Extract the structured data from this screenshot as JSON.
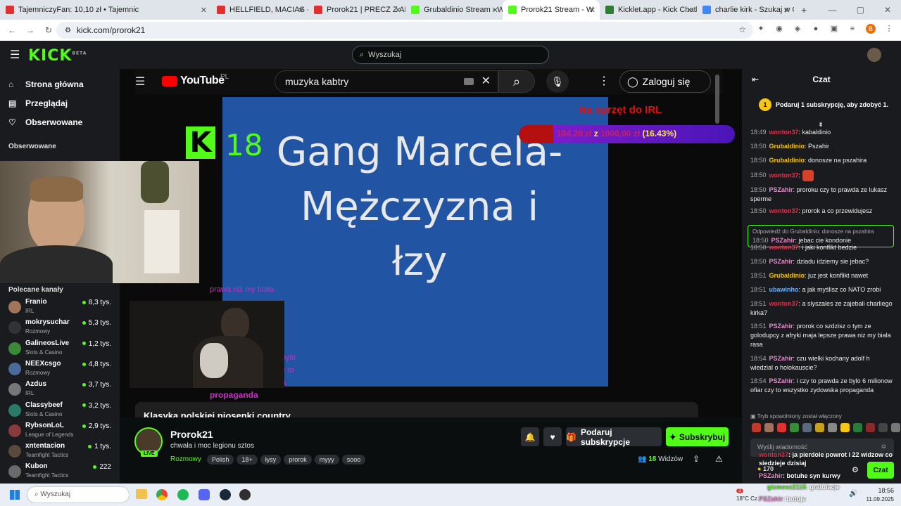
{
  "browser": {
    "tabs": [
      {
        "title": "TajemniczyFan: 10,10 zł • Tajemnic",
        "color": "#e03030"
      },
      {
        "title": "HELLFIELD, MACIAS - Fen",
        "color": "#e03030"
      },
      {
        "title": "Prorok21 | PRECZ Z ABST",
        "color": "#e03030"
      },
      {
        "title": "Grubaldinio Stream - Wa",
        "color": "#53fc18"
      },
      {
        "title": "Prorok21 Stream - W",
        "color": "#53fc18",
        "active": true
      },
      {
        "title": "Kicklet.app - Kick Chatbo",
        "color": "#2e7d32"
      },
      {
        "title": "charlie kirk - Szukaj w Go",
        "color": "#4285f4"
      }
    ],
    "new_tab": "+",
    "url": "kick.com/prorok21",
    "profile_initial": "B"
  },
  "kick": {
    "logo": "KICK",
    "logo_tag": "BETA",
    "search_placeholder": "Wyszukaj",
    "nav": [
      {
        "label": "Strona główna",
        "icon": "home-icon",
        "glyph": "⌂"
      },
      {
        "label": "Przeglądaj",
        "icon": "browse-icon",
        "glyph": "▤"
      },
      {
        "label": "Obserwowane",
        "icon": "heart-icon",
        "glyph": "♡"
      }
    ],
    "followed_title": "Obserwowane",
    "recommended_title": "Polecane kanały",
    "channels": [
      {
        "name": "Franio",
        "category": "IRL",
        "viewers": "8,3 tys.",
        "color": "#a0765a"
      },
      {
        "name": "mokrysuchar",
        "category": "Rozmowy",
        "viewers": "5,3 tys.",
        "color": "#333333"
      },
      {
        "name": "GalineosLive",
        "category": "Slots & Casino",
        "viewers": "1,2 tys.",
        "color": "#3a8a3a"
      },
      {
        "name": "NEEXcsgo",
        "category": "Rozmowy",
        "viewers": "4,8 tys.",
        "color": "#4a6a9a"
      },
      {
        "name": "Azdus",
        "category": "IRL",
        "viewers": "3,7 tys.",
        "color": "#777777"
      },
      {
        "name": "Classybeef",
        "category": "Slots & Casino",
        "viewers": "3,2 tys.",
        "color": "#2a7a6a"
      },
      {
        "name": "RybsonLoL",
        "category": "League of Legends",
        "viewers": "2,9 tys.",
        "color": "#8a3a3a"
      },
      {
        "name": "xntentacion",
        "category": "Teamfight Tactics",
        "viewers": "1 tys.",
        "color": "#5a4a3a"
      },
      {
        "name": "Kubon",
        "category": "Teamfight Tactics",
        "viewers": "222",
        "color": "#6a6a6a"
      }
    ]
  },
  "player": {
    "yt_logo": "YouTube",
    "yt_region": "PL",
    "yt_query": "muzyka kabtry",
    "yt_login": "Zaloguj się",
    "kick_badge": "18",
    "gang_text": "Gang Marcela-\nMężczyzna i\nłzy",
    "goal_title": "Na sprzęt do IRL",
    "goal_amount": "184,28 zł",
    "goal_of": "z",
    "goal_target": "1000,00 zł",
    "goal_pct_text": "(16.43%)",
    "goal_fraction": 0.1643,
    "overlay_text1": "prawa niż my biała",
    "overlay_text2": "bylo\ny to\na",
    "overlay_text3": "propaganda",
    "below_title": "Klasyka polskiej piosenki country"
  },
  "stream": {
    "name": "Prorok21",
    "title": "chwała i moc legionu sztos",
    "live_badge": "LIVE",
    "category": "Rozmowy",
    "tags": [
      "Polish",
      "18+",
      "łysy",
      "prorok",
      "myyy",
      "sooo"
    ],
    "gift_label": "Podaruj subskrypcje",
    "subscribe_label": "Subskrybuj",
    "viewers": "18",
    "viewers_label": "Widzów"
  },
  "chat": {
    "title": "Czat",
    "gift_banner": "Podaruj 1 subskrypcję, aby zdobyć 1.",
    "gift_count": "1",
    "messages": [
      {
        "time": "18:49",
        "user": "wonton37",
        "color": "#e0304a",
        "text": "kabaldinio"
      },
      {
        "time": "18:50",
        "user": "Grubaldinio",
        "color": "#f5c518",
        "text": "Pszahir"
      },
      {
        "time": "18:50",
        "user": "Grubaldinio",
        "color": "#f5c518",
        "text": "donosze na pszahira"
      },
      {
        "time": "18:50",
        "user": "wonton37",
        "color": "#e0304a",
        "text": "",
        "emote": true
      },
      {
        "time": "18:50",
        "user": "PSZahir",
        "color": "#e88acb",
        "text": "proroku czy to prawda ze lukasz sperme"
      },
      {
        "time": "18:50",
        "user": "wonton37",
        "color": "#e0304a",
        "text": "prorok a co przewidujesz"
      },
      {
        "time": "18:50",
        "user": "PSZahir",
        "color": "#e88acb",
        "text": "jebac cie kondonie",
        "reply": "Odpowiedź do Grubaldinio: donosze na pszahira"
      },
      {
        "time": "18:50",
        "user": "wonton37",
        "color": "#e0304a",
        "text": "i jaki konflikt bedzie"
      },
      {
        "time": "18:50",
        "user": "PSZahir",
        "color": "#e88acb",
        "text": "dziadu idziemy sie jebac?"
      },
      {
        "time": "18:51",
        "user": "Grubaldinio",
        "color": "#f5c518",
        "text": "juz jest konflikt nawet"
      },
      {
        "time": "18:51",
        "user": "ubawinho",
        "color": "#6ab0ff",
        "text": "a jak myślisz co NATO zrobi"
      },
      {
        "time": "18:51",
        "user": "wonton37",
        "color": "#e0304a",
        "text": "a slyszales ze zajebali charliego kirka?"
      },
      {
        "time": "18:51",
        "user": "PSZahir",
        "color": "#e88acb",
        "text": "prorok co szdzisz o tym ze golodupcy z afryki maja lepsze prawa niz my biala rasa"
      },
      {
        "time": "18:54",
        "user": "PSZahir",
        "color": "#e88acb",
        "text": "czu wielki kochany adolf h wiedzial o holokauscie?"
      },
      {
        "time": "18:54",
        "user": "PSZahir",
        "color": "#e88acb",
        "text": "i czy to prawda ze bylo 6 milionow ofiar czy to wszystko zydowska propaganda"
      }
    ],
    "slow_mode": "Tryb spowolniony został włączony",
    "input_placeholder": "Wyślij wiadomość",
    "points": "170",
    "send_label": "Czat",
    "overlay_msgs": [
      {
        "user": "wonton37",
        "text": "ja pierdole powrot i 22 widzow co siedzieje dzisiaj"
      },
      {
        "user": "PSZahir",
        "text": "botuhe syn kurwy"
      }
    ]
  },
  "taskbar": {
    "search_placeholder": "Wyszukaj",
    "weather_badge": "3",
    "weather_temp": "18°C",
    "weather_sub": "Cz.",
    "time": "18:56",
    "date": "11.09.2025",
    "overlay_msgs": [
      {
        "user": "gizmoez2115",
        "text": "gratulacje"
      },
      {
        "user": "PSZahir",
        "text": "botuje"
      }
    ]
  }
}
